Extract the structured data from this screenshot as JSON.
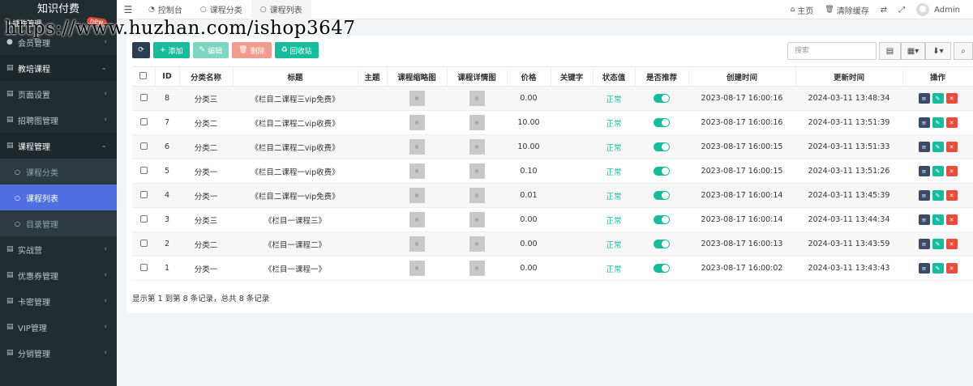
{
  "brand": {
    "title": "知识付费",
    "badge": "new"
  },
  "watermark": {
    "url": "https://www.huzhan.com/ishop3647"
  },
  "sidebar": {
    "top_partial": "插件管理",
    "items": [
      {
        "label": "会员管理",
        "icon": "user-circle-icon",
        "type": "group"
      },
      {
        "label": "教培课程",
        "icon": "folder-icon",
        "type": "open"
      },
      {
        "label": "页面设置",
        "icon": "list-icon",
        "type": "group"
      },
      {
        "label": "招聘图管理",
        "icon": "list-icon",
        "type": "group"
      },
      {
        "label": "课程管理",
        "icon": "list-icon",
        "type": "open"
      },
      {
        "label": "课程分类",
        "icon": "circle-icon",
        "type": "sub"
      },
      {
        "label": "课程列表",
        "icon": "circle-icon",
        "type": "active"
      },
      {
        "label": "目录管理",
        "icon": "circle-icon",
        "type": "sub"
      },
      {
        "label": "实战营",
        "icon": "list-icon",
        "type": "group"
      },
      {
        "label": "优惠券管理",
        "icon": "list-icon",
        "type": "group"
      },
      {
        "label": "卡密管理",
        "icon": "list-icon",
        "type": "group"
      },
      {
        "label": "VIP管理",
        "icon": "list-icon",
        "type": "group"
      },
      {
        "label": "分销管理",
        "icon": "list-icon",
        "type": "group"
      }
    ]
  },
  "topbar": {
    "tabs": [
      {
        "label": "控制台",
        "icon": "dashboard-icon"
      },
      {
        "label": "课程分类",
        "icon": "circle-icon"
      },
      {
        "label": "课程列表",
        "icon": "circle-icon",
        "active": true
      }
    ],
    "right": {
      "home": "主页",
      "clear_cache": "清除缓存",
      "admin": "Admin"
    }
  },
  "toolbar": {
    "add": "添加",
    "edit": "编辑",
    "delete": "删除",
    "recycle": "回收站",
    "search_placeholder": "搜索"
  },
  "table": {
    "headers": [
      "ID",
      "分类名称",
      "标题",
      "主题",
      "课程缩略图",
      "课程详情图",
      "价格",
      "关键字",
      "状态值",
      "是否推荐",
      "创建时间",
      "更新时间",
      "操作"
    ],
    "rows": [
      {
        "id": "8",
        "category": "分类三",
        "title": "《栏目二课程三vip免费》",
        "theme": "",
        "price": "0.00",
        "keyword": "",
        "status": "正常",
        "created": "2023-08-17 16:00:16",
        "updated": "2024-03-11 13:48:34"
      },
      {
        "id": "7",
        "category": "分类二",
        "title": "《栏目二课程二vip收费》",
        "theme": "",
        "price": "10.00",
        "keyword": "",
        "status": "正常",
        "created": "2023-08-17 16:00:16",
        "updated": "2024-03-11 13:51:39"
      },
      {
        "id": "6",
        "category": "分类二",
        "title": "《栏目二课程二vip收费》",
        "theme": "",
        "price": "10.00",
        "keyword": "",
        "status": "正常",
        "created": "2023-08-17 16:00:15",
        "updated": "2024-03-11 13:51:33"
      },
      {
        "id": "5",
        "category": "分类一",
        "title": "《栏目二课程一vip收费》",
        "theme": "",
        "price": "0.10",
        "keyword": "",
        "status": "正常",
        "created": "2023-08-17 16:00:15",
        "updated": "2024-03-11 13:51:26"
      },
      {
        "id": "4",
        "category": "分类一",
        "title": "《栏目二课程一vip免费》",
        "theme": "",
        "price": "0.01",
        "keyword": "",
        "status": "正常",
        "created": "2023-08-17 16:00:14",
        "updated": "2024-03-11 13:45:39"
      },
      {
        "id": "3",
        "category": "分类三",
        "title": "《栏目一课程三》",
        "theme": "",
        "price": "0.00",
        "keyword": "",
        "status": "正常",
        "created": "2023-08-17 16:00:14",
        "updated": "2024-03-11 13:44:34"
      },
      {
        "id": "2",
        "category": "分类二",
        "title": "《栏目一课程二》",
        "theme": "",
        "price": "0.00",
        "keyword": "",
        "status": "正常",
        "created": "2023-08-17 16:00:13",
        "updated": "2024-03-11 13:43:59"
      },
      {
        "id": "1",
        "category": "分类一",
        "title": "《栏目一课程一》",
        "theme": "",
        "price": "0.00",
        "keyword": "",
        "status": "正常",
        "created": "2023-08-17 16:00:02",
        "updated": "2024-03-11 13:43:43"
      }
    ]
  },
  "pagination": {
    "summary": "显示第 1 到第 8 条记录，总共 8 条记录"
  },
  "colors": {
    "sidebar_bg": "#222d32",
    "active": "#4f6ee0",
    "success": "#18bc9c",
    "danger": "#e74c3c"
  }
}
